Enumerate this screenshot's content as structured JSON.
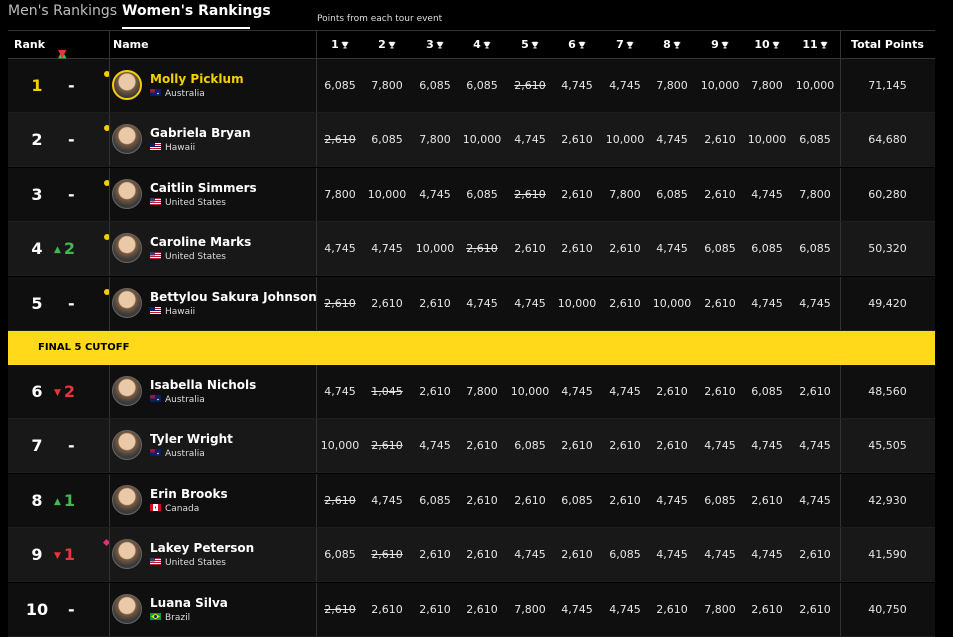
{
  "tabs": {
    "men": "Men's Rankings",
    "women": "Women's Rankings"
  },
  "events_note": "Points from each tour event",
  "headers": {
    "rank": "Rank",
    "name": "Name",
    "events": [
      "1",
      "2",
      "3",
      "4",
      "5",
      "6",
      "7",
      "8",
      "9",
      "10",
      "11"
    ],
    "total": "Total Points"
  },
  "icons": {
    "trophy": "trophy-icon",
    "sort_up": "sort-up-icon",
    "sort_down": "sort-down-icon"
  },
  "cutoff_label": "FINAL 5 CUTOFF",
  "colors": {
    "accent": "#f5d000",
    "cutoff": "#ffd91a",
    "up": "#3fb950",
    "down": "#e5363b"
  },
  "rows_top": [
    {
      "rank": "1",
      "move": "-",
      "move_dir": "same",
      "name": "Molly Picklum",
      "country": "Australia",
      "flag": "au",
      "leader": true,
      "dot": "yellow",
      "scores": [
        "6,085",
        "7,800",
        "6,085",
        "6,085",
        "2,610",
        "4,745",
        "4,745",
        "7,800",
        "10,000",
        "7,800",
        "10,000"
      ],
      "dropped": [
        4
      ],
      "total": "71,145"
    },
    {
      "rank": "2",
      "move": "-",
      "move_dir": "same",
      "name": "Gabriela Bryan",
      "country": "Hawaii",
      "flag": "hi",
      "dot": "yellow",
      "scores": [
        "2,610",
        "6,085",
        "7,800",
        "10,000",
        "4,745",
        "2,610",
        "10,000",
        "4,745",
        "2,610",
        "10,000",
        "6,085"
      ],
      "dropped": [
        0
      ],
      "total": "64,680"
    },
    {
      "rank": "3",
      "move": "-",
      "move_dir": "same",
      "name": "Caitlin Simmers",
      "country": "United States",
      "flag": "us",
      "dot": "yellow",
      "scores": [
        "7,800",
        "10,000",
        "4,745",
        "6,085",
        "2,610",
        "2,610",
        "7,800",
        "6,085",
        "2,610",
        "4,745",
        "7,800"
      ],
      "dropped": [
        4
      ],
      "total": "60,280"
    },
    {
      "rank": "4",
      "move": "2",
      "move_dir": "up",
      "name": "Caroline Marks",
      "country": "United States",
      "flag": "us",
      "dot": "yellow",
      "scores": [
        "4,745",
        "4,745",
        "10,000",
        "2,610",
        "2,610",
        "2,610",
        "2,610",
        "4,745",
        "6,085",
        "6,085",
        "6,085"
      ],
      "dropped": [
        3
      ],
      "total": "50,320"
    },
    {
      "rank": "5",
      "move": "-",
      "move_dir": "same",
      "name": "Bettylou Sakura Johnson",
      "country": "Hawaii",
      "flag": "hi",
      "dot": "yellow",
      "scores": [
        "2,610",
        "2,610",
        "2,610",
        "4,745",
        "4,745",
        "10,000",
        "2,610",
        "10,000",
        "2,610",
        "4,745",
        "4,745"
      ],
      "dropped": [
        0
      ],
      "total": "49,420"
    }
  ],
  "rows_bottom": [
    {
      "rank": "6",
      "move": "2",
      "move_dir": "down",
      "name": "Isabella Nichols",
      "country": "Australia",
      "flag": "au",
      "scores": [
        "4,745",
        "1,045",
        "2,610",
        "7,800",
        "10,000",
        "4,745",
        "4,745",
        "2,610",
        "2,610",
        "6,085",
        "2,610"
      ],
      "dropped": [
        1
      ],
      "total": "48,560"
    },
    {
      "rank": "7",
      "move": "-",
      "move_dir": "same",
      "name": "Tyler Wright",
      "country": "Australia",
      "flag": "au",
      "scores": [
        "10,000",
        "2,610",
        "4,745",
        "2,610",
        "6,085",
        "2,610",
        "2,610",
        "2,610",
        "4,745",
        "4,745",
        "4,745"
      ],
      "dropped": [
        1
      ],
      "total": "45,505"
    },
    {
      "rank": "8",
      "move": "1",
      "move_dir": "up",
      "name": "Erin Brooks",
      "country": "Canada",
      "flag": "ca",
      "scores": [
        "2,610",
        "4,745",
        "6,085",
        "2,610",
        "2,610",
        "6,085",
        "2,610",
        "4,745",
        "6,085",
        "2,610",
        "4,745"
      ],
      "dropped": [
        0
      ],
      "total": "42,930"
    },
    {
      "rank": "9",
      "move": "1",
      "move_dir": "down",
      "name": "Lakey Peterson",
      "country": "United States",
      "flag": "us",
      "dot": "pink",
      "scores": [
        "6,085",
        "2,610",
        "2,610",
        "2,610",
        "4,745",
        "2,610",
        "6,085",
        "4,745",
        "4,745",
        "4,745",
        "2,610"
      ],
      "dropped": [
        1
      ],
      "total": "41,590"
    },
    {
      "rank": "10",
      "move": "-",
      "move_dir": "same",
      "name": "Luana Silva",
      "country": "Brazil",
      "flag": "br",
      "scores": [
        "2,610",
        "2,610",
        "2,610",
        "2,610",
        "7,800",
        "4,745",
        "4,745",
        "2,610",
        "7,800",
        "2,610",
        "2,610"
      ],
      "dropped": [
        0
      ],
      "total": "40,750"
    }
  ]
}
